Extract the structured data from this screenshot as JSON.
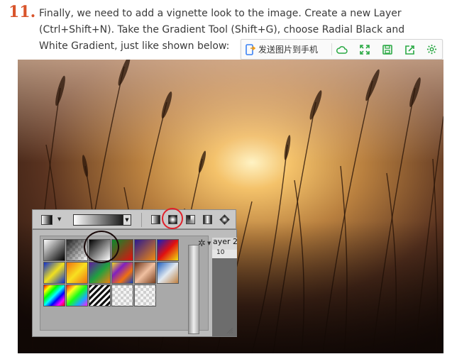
{
  "step": {
    "number": "11."
  },
  "instructions": {
    "line1": "Finally, we need to add a vignette look to the image. Create a new Layer",
    "line2": "(Ctrl+Shift+N). Take the Gradient Tool (Shift+G), choose Radial Black and",
    "line3": "White Gradient, just like shown below:"
  },
  "float_toolbar": {
    "send_label": "发送图片到手机",
    "buttons": [
      "cloud-icon",
      "expand-icon",
      "save-icon",
      "share-icon",
      "settings-icon"
    ],
    "icon_color": "#2aa944",
    "send_icon_colors": [
      "#f39c12",
      "#3b82f6"
    ]
  },
  "photoshop_panel": {
    "layer_label": "ayer 2",
    "ruler_label": "10",
    "gradient_styles": [
      "linear",
      "radial",
      "angle",
      "reflected",
      "diamond"
    ],
    "selected_style": "radial",
    "annotation_color": "#e0202a",
    "presets": [
      "foreground-to-background",
      "foreground-to-transparent",
      "black-white",
      "red-green",
      "violet-orange",
      "blue-red-yellow",
      "blue-yellow-blue",
      "orange-yellow-orange",
      "violet-green-orange",
      "copper",
      "chrome",
      "yellow-violet-orange-blue",
      "spectrum",
      "transparent-rainbow",
      "transparent-stripes",
      "transparent-checker",
      "checker-2"
    ],
    "selected_preset": "black-white"
  }
}
